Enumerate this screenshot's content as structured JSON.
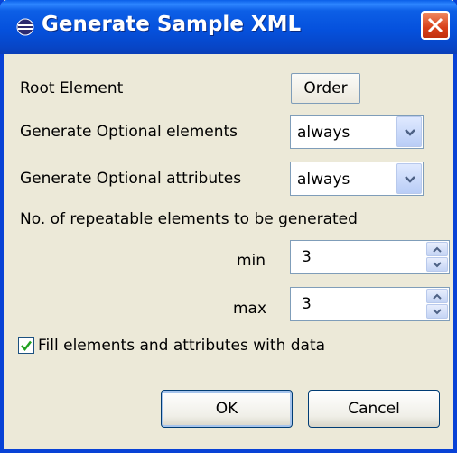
{
  "window": {
    "title": "Generate Sample XML",
    "close_icon": "close-icon"
  },
  "form": {
    "root_element_label": "Root Element",
    "root_element_value": "Order",
    "gen_optional_elements_label": "Generate Optional elements",
    "gen_optional_elements_value": "always",
    "gen_optional_attributes_label": "Generate Optional attributes",
    "gen_optional_attributes_value": "always",
    "repeatable_label": "No. of repeatable elements to be generated",
    "min_label": "min",
    "min_value": "3",
    "max_label": "max",
    "max_value": "3",
    "fill_data_label": "Fill elements and attributes with data",
    "fill_data_checked": true
  },
  "buttons": {
    "ok_label": "OK",
    "cancel_label": "Cancel"
  },
  "colors": {
    "titlebar": "#0551dd",
    "dialog_bg": "#ece9d8",
    "close_button": "#d8401a",
    "checkmark": "#21a121"
  }
}
